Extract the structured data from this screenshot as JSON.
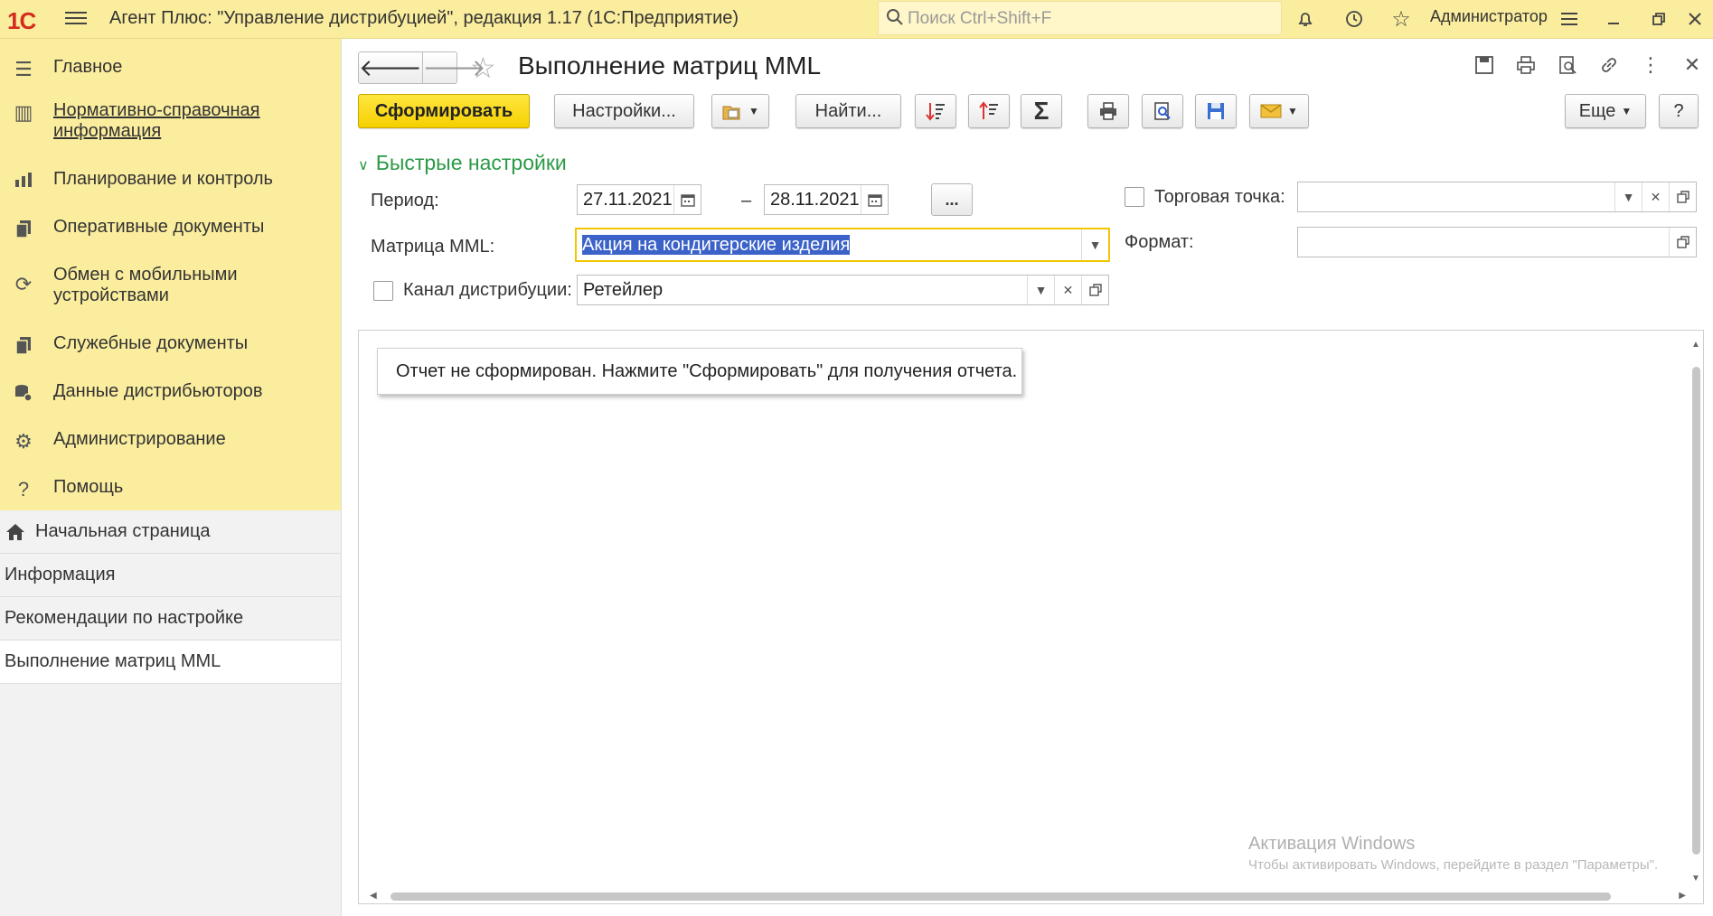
{
  "topbar": {
    "logo": "1С",
    "title": "Агент Плюс: \"Управление дистрибуцией\", редакция 1.17  (1С:Предприятие)",
    "search_placeholder": "Поиск Ctrl+Shift+F",
    "user": "Администратор",
    "icons": [
      "bell-icon",
      "history-icon",
      "star-icon",
      "menu-lines-icon",
      "minimize-icon",
      "restore-icon",
      "close-icon"
    ]
  },
  "sidebar": {
    "sections": [
      {
        "label": "Главное",
        "icon": "menu-lines-icon"
      },
      {
        "label": "Нормативно-справочная информация",
        "icon": "grid-icon"
      },
      {
        "label": "Планирование и контроль",
        "icon": "bar-chart-icon"
      },
      {
        "label": "Оперативные документы",
        "icon": "documents-icon"
      },
      {
        "label": "Обмен с мобильными устройствами",
        "icon": "sync-icon"
      },
      {
        "label": "Служебные документы",
        "icon": "documents-icon"
      },
      {
        "label": "Данные дистрибьюторов",
        "icon": "database-icon"
      },
      {
        "label": "Администрирование",
        "icon": "gear-icon"
      },
      {
        "label": "Помощь",
        "icon": "question-icon"
      }
    ],
    "open_windows": [
      {
        "label": "Начальная страница",
        "icon": "home-icon"
      },
      {
        "label": "Информация"
      },
      {
        "label": "Рекомендации по настройке"
      },
      {
        "label": "Выполнение матриц MML"
      }
    ]
  },
  "form": {
    "title": "Выполнение матриц MML",
    "toolbar": {
      "generate": "Сформировать",
      "settings": "Настройки...",
      "find": "Найти...",
      "more": "Еще",
      "help": "?"
    },
    "quick_settings": {
      "title": "Быстрые настройки",
      "period_label": "Период:",
      "period_from": "27.11.2021",
      "period_dash": "–",
      "period_to": "28.11.2021",
      "dots": "...",
      "matrix_label": "Матрица MML:",
      "matrix_value": "Акция на кондитерские изделия",
      "channel_label": "Канал дистрибуции:",
      "channel_value": "Ретейлер",
      "outlet_label": "Торговая точка:",
      "outlet_value": "",
      "format_label": "Формат:",
      "format_value": ""
    },
    "report_message": "Отчет не сформирован. Нажмите \"Сформировать\" для получения отчета."
  },
  "watermark": {
    "line1": "Активация Windows",
    "line2": "Чтобы активировать Windows, перейдите в раздел \"Параметры\"."
  }
}
